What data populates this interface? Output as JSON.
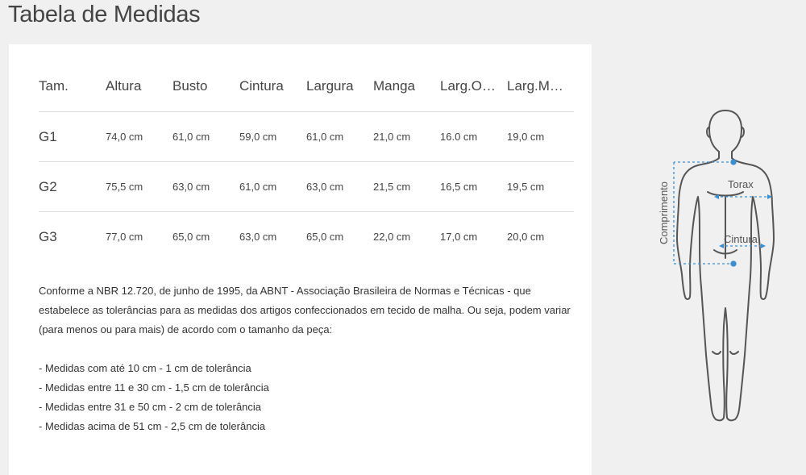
{
  "page": {
    "title": "Tabela de Medidas"
  },
  "table": {
    "headers": [
      "Tam.",
      "Altura",
      "Busto",
      "Cintura",
      "Largura",
      "Manga",
      "Larg.O…",
      "Larg.M…"
    ],
    "rows": [
      [
        "G1",
        "74,0 cm",
        "61,0 cm",
        "59,0 cm",
        "61,0 cm",
        "21,0 cm",
        "16.0 cm",
        "19,0 cm"
      ],
      [
        "G2",
        "75,5 cm",
        "63,0 cm",
        "61,0 cm",
        "63,0 cm",
        "21,5 cm",
        "16,5 cm",
        "19,5 cm"
      ],
      [
        "G3",
        "77,0 cm",
        "65,0 cm",
        "63,0 cm",
        "65,0 cm",
        "22,0 cm",
        "17,0 cm",
        "20,0 cm"
      ]
    ]
  },
  "notes": {
    "intro": "Conforme a NBR 12.720, de junho de 1995, da ABNT - Associação Brasileira de Normas e Técnicas - que estabelece as tolerâncias para as medidas dos artigos confeccionados em tecido de malha. Ou seja, podem variar (para menos ou para mais) de acordo com o tamanho da peça:",
    "items": [
      "- Medidas com até 10 cm - 1 cm de tolerância",
      "- Medidas entre 11 e 30 cm - 1,5 cm de tolerância",
      "- Medidas entre 31 e 50 cm - 2 cm de tolerância",
      "- Medidas acima de 51 cm - 2,5 cm de tolerância"
    ]
  },
  "figure": {
    "label_length": "Comprimento",
    "label_chest": "Torax",
    "label_waist": "Cintura",
    "accent_color": "#3a8fd1",
    "outline_color": "#555555"
  }
}
